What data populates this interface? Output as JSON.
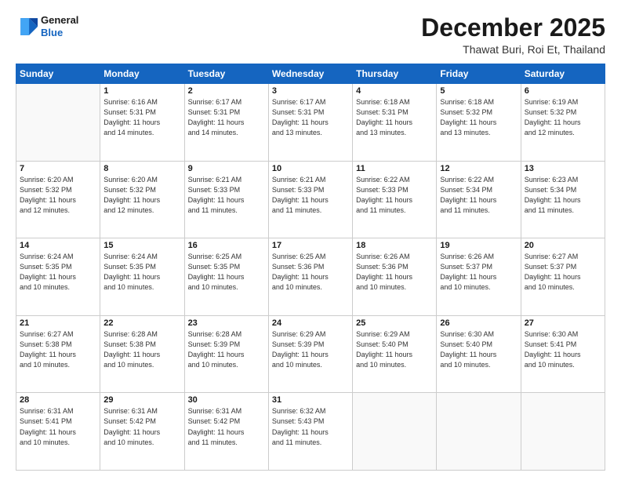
{
  "logo": {
    "line1": "General",
    "line2": "Blue"
  },
  "title": {
    "month_year": "December 2025",
    "location": "Thawat Buri, Roi Et, Thailand"
  },
  "days_of_week": [
    "Sunday",
    "Monday",
    "Tuesday",
    "Wednesday",
    "Thursday",
    "Friday",
    "Saturday"
  ],
  "weeks": [
    [
      {
        "day": "",
        "info": ""
      },
      {
        "day": "1",
        "info": "Sunrise: 6:16 AM\nSunset: 5:31 PM\nDaylight: 11 hours\nand 14 minutes."
      },
      {
        "day": "2",
        "info": "Sunrise: 6:17 AM\nSunset: 5:31 PM\nDaylight: 11 hours\nand 14 minutes."
      },
      {
        "day": "3",
        "info": "Sunrise: 6:17 AM\nSunset: 5:31 PM\nDaylight: 11 hours\nand 13 minutes."
      },
      {
        "day": "4",
        "info": "Sunrise: 6:18 AM\nSunset: 5:31 PM\nDaylight: 11 hours\nand 13 minutes."
      },
      {
        "day": "5",
        "info": "Sunrise: 6:18 AM\nSunset: 5:32 PM\nDaylight: 11 hours\nand 13 minutes."
      },
      {
        "day": "6",
        "info": "Sunrise: 6:19 AM\nSunset: 5:32 PM\nDaylight: 11 hours\nand 12 minutes."
      }
    ],
    [
      {
        "day": "7",
        "info": "Sunrise: 6:20 AM\nSunset: 5:32 PM\nDaylight: 11 hours\nand 12 minutes."
      },
      {
        "day": "8",
        "info": "Sunrise: 6:20 AM\nSunset: 5:32 PM\nDaylight: 11 hours\nand 12 minutes."
      },
      {
        "day": "9",
        "info": "Sunrise: 6:21 AM\nSunset: 5:33 PM\nDaylight: 11 hours\nand 11 minutes."
      },
      {
        "day": "10",
        "info": "Sunrise: 6:21 AM\nSunset: 5:33 PM\nDaylight: 11 hours\nand 11 minutes."
      },
      {
        "day": "11",
        "info": "Sunrise: 6:22 AM\nSunset: 5:33 PM\nDaylight: 11 hours\nand 11 minutes."
      },
      {
        "day": "12",
        "info": "Sunrise: 6:22 AM\nSunset: 5:34 PM\nDaylight: 11 hours\nand 11 minutes."
      },
      {
        "day": "13",
        "info": "Sunrise: 6:23 AM\nSunset: 5:34 PM\nDaylight: 11 hours\nand 11 minutes."
      }
    ],
    [
      {
        "day": "14",
        "info": "Sunrise: 6:24 AM\nSunset: 5:35 PM\nDaylight: 11 hours\nand 10 minutes."
      },
      {
        "day": "15",
        "info": "Sunrise: 6:24 AM\nSunset: 5:35 PM\nDaylight: 11 hours\nand 10 minutes."
      },
      {
        "day": "16",
        "info": "Sunrise: 6:25 AM\nSunset: 5:35 PM\nDaylight: 11 hours\nand 10 minutes."
      },
      {
        "day": "17",
        "info": "Sunrise: 6:25 AM\nSunset: 5:36 PM\nDaylight: 11 hours\nand 10 minutes."
      },
      {
        "day": "18",
        "info": "Sunrise: 6:26 AM\nSunset: 5:36 PM\nDaylight: 11 hours\nand 10 minutes."
      },
      {
        "day": "19",
        "info": "Sunrise: 6:26 AM\nSunset: 5:37 PM\nDaylight: 11 hours\nand 10 minutes."
      },
      {
        "day": "20",
        "info": "Sunrise: 6:27 AM\nSunset: 5:37 PM\nDaylight: 11 hours\nand 10 minutes."
      }
    ],
    [
      {
        "day": "21",
        "info": "Sunrise: 6:27 AM\nSunset: 5:38 PM\nDaylight: 11 hours\nand 10 minutes."
      },
      {
        "day": "22",
        "info": "Sunrise: 6:28 AM\nSunset: 5:38 PM\nDaylight: 11 hours\nand 10 minutes."
      },
      {
        "day": "23",
        "info": "Sunrise: 6:28 AM\nSunset: 5:39 PM\nDaylight: 11 hours\nand 10 minutes."
      },
      {
        "day": "24",
        "info": "Sunrise: 6:29 AM\nSunset: 5:39 PM\nDaylight: 11 hours\nand 10 minutes."
      },
      {
        "day": "25",
        "info": "Sunrise: 6:29 AM\nSunset: 5:40 PM\nDaylight: 11 hours\nand 10 minutes."
      },
      {
        "day": "26",
        "info": "Sunrise: 6:30 AM\nSunset: 5:40 PM\nDaylight: 11 hours\nand 10 minutes."
      },
      {
        "day": "27",
        "info": "Sunrise: 6:30 AM\nSunset: 5:41 PM\nDaylight: 11 hours\nand 10 minutes."
      }
    ],
    [
      {
        "day": "28",
        "info": "Sunrise: 6:31 AM\nSunset: 5:41 PM\nDaylight: 11 hours\nand 10 minutes."
      },
      {
        "day": "29",
        "info": "Sunrise: 6:31 AM\nSunset: 5:42 PM\nDaylight: 11 hours\nand 10 minutes."
      },
      {
        "day": "30",
        "info": "Sunrise: 6:31 AM\nSunset: 5:42 PM\nDaylight: 11 hours\nand 11 minutes."
      },
      {
        "day": "31",
        "info": "Sunrise: 6:32 AM\nSunset: 5:43 PM\nDaylight: 11 hours\nand 11 minutes."
      },
      {
        "day": "",
        "info": ""
      },
      {
        "day": "",
        "info": ""
      },
      {
        "day": "",
        "info": ""
      }
    ]
  ]
}
